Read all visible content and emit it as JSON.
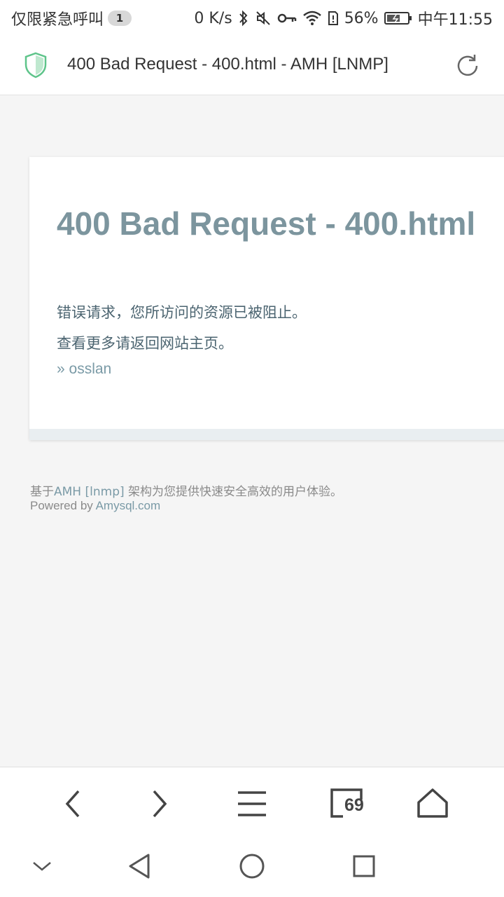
{
  "status_bar": {
    "carrier": "仅限紧急呼叫",
    "notification_count": "1",
    "net_speed": "0 K/s",
    "battery": "56%",
    "time": "中午11:55"
  },
  "address_bar": {
    "title": "400 Bad Request - 400.html - AMH [LNMP]"
  },
  "page": {
    "heading": "400 Bad Request - 400.html",
    "message_line1": "错误请求，您所访问的资源已被阻止。",
    "message_line2": "查看更多请返回网站主页。",
    "link_text": "» osslan",
    "footer_prefix": "基于",
    "footer_amh_link": "AMH",
    "footer_lnmp_link": "[lnmp]",
    "footer_suffix": " 架构为您提供快速安全高效的用户体验。",
    "powered_by": "Powered by ",
    "powered_link": "Amysql.com"
  },
  "toolbar": {
    "tab_count": "69",
    "icons": [
      "back-icon",
      "forward-icon",
      "menu-icon",
      "tabs-icon",
      "home-icon"
    ]
  },
  "system_nav": {
    "icons": [
      "collapse-icon",
      "nav-back-icon",
      "nav-home-icon",
      "nav-recent-icon"
    ]
  }
}
